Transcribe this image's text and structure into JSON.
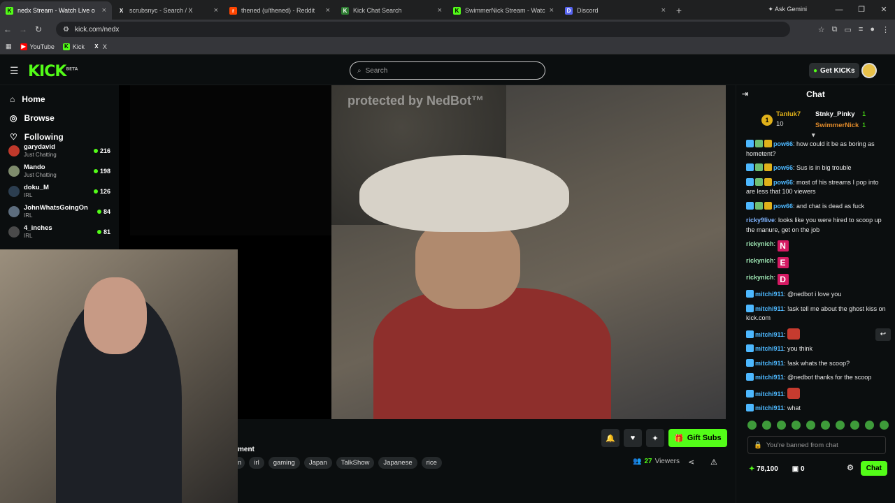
{
  "browser": {
    "tabs": [
      {
        "title": "nedx Stream - Watch Live o",
        "fav": "K",
        "favbg": "#53fc18",
        "active": true
      },
      {
        "title": "scrubsnyc - Search / X",
        "fav": "X",
        "favbg": "#1f2021"
      },
      {
        "title": "thened (u/thened) - Reddit",
        "fav": "r",
        "favbg": "#ff4500"
      },
      {
        "title": "Kick Chat Search",
        "fav": "K",
        "favbg": "#2e7d32"
      },
      {
        "title": "SwimmerNick Stream - Watch L",
        "fav": "K",
        "favbg": "#53fc18"
      },
      {
        "title": "Discord",
        "fav": "D",
        "favbg": "#5865f2"
      }
    ],
    "gemini_label": "Ask Gemini",
    "url": "kick.com/nedx",
    "bookmarks": [
      "YouTube",
      "Kick",
      "X"
    ]
  },
  "header": {
    "logo": "KICK",
    "logo_badge": "BETA",
    "search_placeholder": "Search",
    "get_kicks": "Get KICKs"
  },
  "sidebar": {
    "nav": [
      {
        "label": "Home",
        "icon": "home-icon"
      },
      {
        "label": "Browse",
        "icon": "browse-icon"
      },
      {
        "label": "Following",
        "icon": "heart-icon"
      }
    ],
    "channels": [
      {
        "name": "garydavid",
        "category": "Just Chatting",
        "viewers": "216",
        "color": "#c0392b"
      },
      {
        "name": "Mando",
        "category": "Just Chatting",
        "viewers": "198",
        "color": "#7f8c6d"
      },
      {
        "name": "doku_M",
        "category": "IRL",
        "viewers": "126",
        "color": "#2c3e50"
      },
      {
        "name": "JohnWhatsGoingOn",
        "category": "IRL",
        "viewers": "84",
        "color": "#5d6d7e"
      },
      {
        "name": "4_inches",
        "category": "IRL",
        "viewers": "81",
        "color": "#4a4a4a"
      }
    ]
  },
  "player": {
    "watermark": "protected by NedBot™"
  },
  "stream_info": {
    "category_fragment": "ment",
    "tags": [
      "n",
      "irl",
      "gaming",
      "Japan",
      "TalkShow",
      "Japanese",
      "rice"
    ],
    "gift_subs": "Gift Subs",
    "viewers_count": "27",
    "viewers_label": "Viewers"
  },
  "chat": {
    "title": "Chat",
    "leaderboard": {
      "first": {
        "name": "Tanluk7",
        "count": "10",
        "rank": "1"
      },
      "second": {
        "name": "Stnky_Pinky",
        "count": "1"
      },
      "third": {
        "name": "SwimmerNick",
        "count": "1"
      }
    },
    "messages": [
      {
        "user": "pow66",
        "color": "#4db8ff",
        "text": ": how could it be as boring as hometent?",
        "badges": 3
      },
      {
        "user": "pow66",
        "color": "#4db8ff",
        "text": ": Sus is in big trouble",
        "badges": 3
      },
      {
        "user": "pow66",
        "color": "#4db8ff",
        "text": ": most of his streams I pop into are less that 100 viewers",
        "badges": 3
      },
      {
        "user": "pow66",
        "color": "#4db8ff",
        "text": ": and chat is dead as fuck",
        "badges": 3
      },
      {
        "user": "ricky9live",
        "color": "#7fb3ff",
        "text": ": looks like you were hired to scoop up the manure, get on the job",
        "badges": 0
      },
      {
        "user": "rickynich",
        "color": "#9ee6b3",
        "text": ": ",
        "emote": "N",
        "badges": 0
      },
      {
        "user": "rickynich",
        "color": "#9ee6b3",
        "text": ": ",
        "emote": "E",
        "badges": 0
      },
      {
        "user": "rickynich",
        "color": "#9ee6b3",
        "text": ": ",
        "emote": "D",
        "badges": 0
      },
      {
        "user": "mitchi911",
        "color": "#4db8ff",
        "text": ": @nedbot i love you",
        "badges": 1
      },
      {
        "user": "mitchi911",
        "color": "#4db8ff",
        "text": ": !ask tell me about the ghost kiss on kick.com",
        "badges": 1
      },
      {
        "user": "mitchi911",
        "color": "#4db8ff",
        "text": ": ",
        "emoteImg": true,
        "badges": 1
      },
      {
        "user": "mitchi911",
        "color": "#4db8ff",
        "text": ": you think",
        "badges": 1
      },
      {
        "user": "mitchi911",
        "color": "#4db8ff",
        "text": ": !ask whats the scoop?",
        "badges": 1
      },
      {
        "user": "mitchi911",
        "color": "#4db8ff",
        "text": ": @nedbot thanks for the scoop",
        "badges": 1
      },
      {
        "user": "mitchi911",
        "color": "#4db8ff",
        "text": ": ",
        "emoteImg": true,
        "badges": 1
      },
      {
        "user": "mitchi911",
        "color": "#4db8ff",
        "text": ": what",
        "badges": 1
      }
    ],
    "banned_text": "You're banned from chat",
    "kicks_balance": "78,100",
    "points": "0",
    "chat_button": "Chat"
  },
  "colors": {
    "brand": "#53fc18"
  }
}
